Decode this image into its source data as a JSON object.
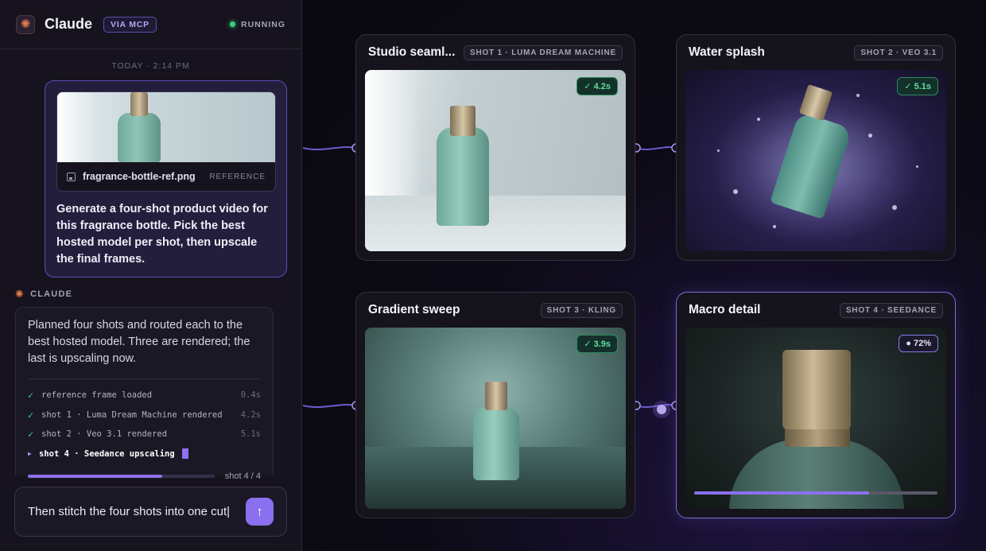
{
  "app": {
    "name": "Claude",
    "via": "VIA MCP",
    "status": "RUNNING"
  },
  "chat": {
    "timestamp": "TODAY · 2:14 PM",
    "user_message": {
      "attachment_name": "fragrance-bottle-ref.png",
      "attachment_tag": "REFERENCE",
      "text": "Generate a four-shot product video for this fragrance bottle. Pick the best hosted model per shot, then upscale the final frames."
    },
    "assistant": {
      "label": "CLAUDE",
      "text": "Planned four shots and routed each to the best hosted model. Three are rendered; the last is upscaling now.",
      "log": [
        {
          "text": "reference frame loaded",
          "time": "0.4s"
        },
        {
          "text": "shot 1 · Luma Dream Machine rendered",
          "time": "4.2s"
        },
        {
          "text": "shot 2 · Veo 3.1 rendered",
          "time": "5.1s"
        }
      ],
      "active_step": "shot 4 · Seedance upscaling",
      "progress": 0.72,
      "progress_label": "shot 4 / 4"
    },
    "composer": {
      "value": "Then stitch the four shots into one cut|"
    }
  },
  "shots": [
    {
      "title": "Studio seaml...",
      "tag": "SHOT 1 · LUMA DREAM MACHINE",
      "badge": "✓ 4.2s",
      "state": "done"
    },
    {
      "title": "Water splash",
      "tag": "SHOT 2 · VEO 3.1",
      "badge": "✓ 5.1s",
      "state": "done"
    },
    {
      "title": "Gradient sweep",
      "tag": "SHOT 3 · KLING",
      "badge": "✓ 3.9s",
      "state": "done"
    },
    {
      "title": "Macro detail",
      "tag": "SHOT 4 · SEEDANCE",
      "badge": "● 72%",
      "state": "rendering",
      "progress": 0.72
    }
  ],
  "colors": {
    "accent": "#8a70ee",
    "success": "#38d07a",
    "claude_orange": "#e07a4a"
  }
}
